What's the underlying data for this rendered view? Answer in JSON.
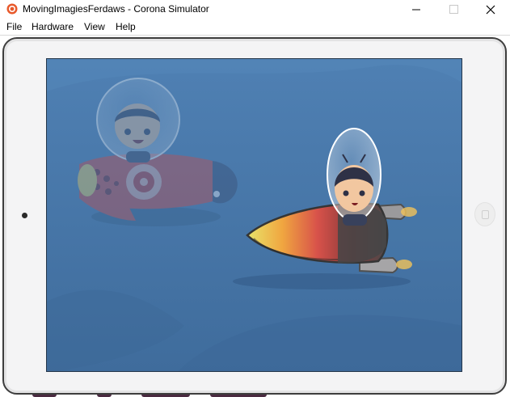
{
  "window": {
    "title": "MovingImagiesFerdaws - Corona Simulator",
    "app_icon": "corona-icon",
    "controls": [
      "minimize-icon",
      "maximize-icon",
      "close-icon"
    ]
  },
  "menu": {
    "items": [
      {
        "label": "File"
      },
      {
        "label": "Hardware"
      },
      {
        "label": "View"
      },
      {
        "label": "Help"
      }
    ]
  },
  "device": {
    "type": "iPad",
    "screen": {
      "background": "#4c7db0",
      "sprites": [
        {
          "name": "faded-astronaut-red-rocket",
          "faded": true
        },
        {
          "name": "astronaut-grey-rocket",
          "faded": false
        }
      ]
    }
  },
  "colors": {
    "frame": "#f4f4f5",
    "frame_border": "#3d3d3d",
    "screen_bg": "#4c7db0"
  }
}
